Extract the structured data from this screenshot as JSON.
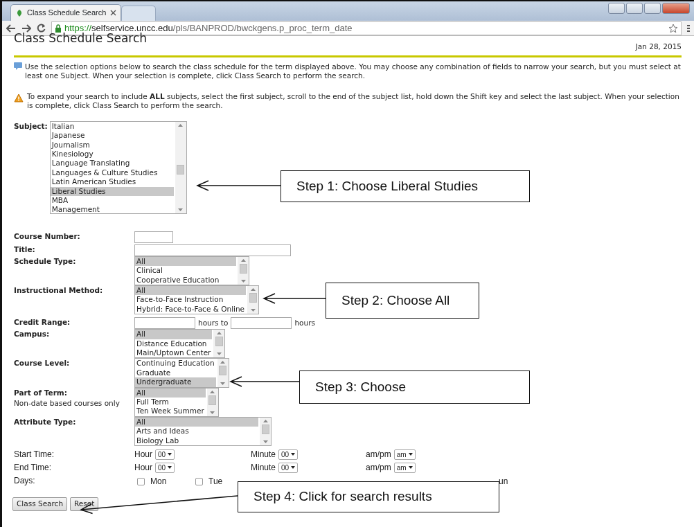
{
  "browser": {
    "tab_title": "Class Schedule Search",
    "url_scheme": "https://",
    "url_host": "selfservice.uncc.edu",
    "url_path": "/pls/BANPROD/bwckgens.p_proc_term_date"
  },
  "page": {
    "title": "Class Schedule Search",
    "date": "Jan 28, 2015"
  },
  "notes": [
    {
      "kind": "info",
      "text": "Use the selection options below to search the class schedule for the term displayed above. You may choose any combination of fields to narrow your search, but you must select at least one Subject. When your selection is complete, click Class Search to perform the search."
    },
    {
      "kind": "warning",
      "text": "To expand your search to include **ALL** subjects, select the first subject, scroll to the end of the subject list, hold down the Shift key and select the last subject. When your selection is complete, click Class Search to perform the search."
    }
  ],
  "subject": {
    "label": "Subject:",
    "options": [
      {
        "label": "Italian",
        "selected": false
      },
      {
        "label": "Japanese",
        "selected": false
      },
      {
        "label": "Journalism",
        "selected": false
      },
      {
        "label": "Kinesiology",
        "selected": false
      },
      {
        "label": "Language Translating",
        "selected": false
      },
      {
        "label": "Languages & Culture Studies",
        "selected": false
      },
      {
        "label": "Latin American Studies",
        "selected": false
      },
      {
        "label": "Liberal Studies",
        "selected": true
      },
      {
        "label": "MBA",
        "selected": false
      },
      {
        "label": "Management",
        "selected": false
      }
    ]
  },
  "fields": [
    {
      "kind": "short_input",
      "label": "Course Number:"
    },
    {
      "kind": "long_input",
      "label": "Title:"
    },
    {
      "kind": "listbox",
      "label": "Schedule Type:",
      "options": [
        {
          "label": "All",
          "selected": true
        },
        {
          "label": "Clinical",
          "selected": false
        },
        {
          "label": "Cooperative Education",
          "selected": false
        }
      ]
    },
    {
      "kind": "listbox",
      "label": "Instructional Method:",
      "options": [
        {
          "label": "All",
          "selected": true
        },
        {
          "label": "Face-to-Face Instruction",
          "selected": false
        },
        {
          "label": "Hybrid: Face-to-Face & Online",
          "selected": false
        }
      ]
    },
    {
      "kind": "range",
      "label": "Credit Range:",
      "middle": "hours to",
      "unit": "hours"
    },
    {
      "kind": "listbox",
      "label": "Campus:",
      "options": [
        {
          "label": "All",
          "selected": true
        },
        {
          "label": "Distance Education",
          "selected": false
        },
        {
          "label": "Main/Uptown Center",
          "selected": false
        }
      ]
    },
    {
      "kind": "listbox",
      "label": "Course Level:",
      "options": [
        {
          "label": "Continuing Education",
          "selected": false
        },
        {
          "label": "Graduate",
          "selected": false
        },
        {
          "label": "Undergraduate",
          "selected": true
        }
      ]
    },
    {
      "kind": "listbox",
      "label": "Part of Term:",
      "note": "Non-date based courses only",
      "options": [
        {
          "label": "All",
          "selected": true
        },
        {
          "label": "Full Term",
          "selected": false
        },
        {
          "label": "Ten Week Summer",
          "selected": false
        }
      ]
    },
    {
      "kind": "listbox",
      "label": "Attribute Type:",
      "options": [
        {
          "label": "All",
          "selected": true
        },
        {
          "label": "Arts and Ideas",
          "selected": false
        },
        {
          "label": "Biology Lab",
          "selected": false
        }
      ]
    }
  ],
  "times": [
    {
      "label": "Start Time:",
      "parts": [
        {
          "label": "Hour",
          "value": "00"
        },
        {
          "label": "Minute",
          "value": "00"
        },
        {
          "label": "am/pm",
          "value": "am"
        }
      ]
    },
    {
      "label": "End Time:",
      "parts": [
        {
          "label": "Hour",
          "value": "00"
        },
        {
          "label": "Minute",
          "value": "00"
        },
        {
          "label": "am/pm",
          "value": "am"
        }
      ]
    }
  ],
  "days": {
    "label": "Days:",
    "items": [
      {
        "kind": "day",
        "label": "Mon",
        "checked": false
      },
      {
        "kind": "day",
        "label": "Tue",
        "checked": false
      },
      {
        "kind": "fragment",
        "label": "un"
      }
    ]
  },
  "buttons": [
    "Class Search",
    "Reset"
  ],
  "callouts": [
    {
      "text": "Step 1: Choose Liberal Studies"
    },
    {
      "text": "Step 2: Choose All"
    },
    {
      "text": "Step 3: Choose"
    },
    {
      "text": "Step 4: Click for search results"
    }
  ]
}
